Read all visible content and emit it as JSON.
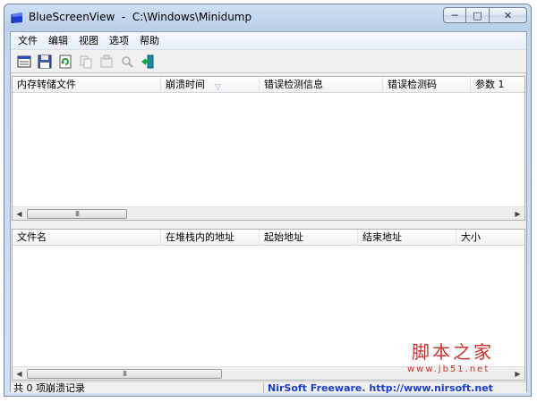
{
  "window": {
    "title": "BlueScreenView  -  C:\\Windows\\Minidump",
    "caption_buttons": {
      "minimize": "─",
      "maximize": "□",
      "close": "✕"
    }
  },
  "menu": [
    "文件",
    "编辑",
    "视图",
    "选项",
    "帮助"
  ],
  "toolbar": {
    "buttons": [
      "properties-icon",
      "save-icon",
      "refresh-icon",
      "copy-icon",
      "copy-props-icon",
      "find-icon",
      "exit-icon"
    ]
  },
  "top_pane": {
    "columns": [
      "内存转储文件",
      "崩溃时间",
      "错误检测信息",
      "错误检测码",
      "参数 1"
    ],
    "sort_indicator": "▽",
    "rows": []
  },
  "bottom_pane": {
    "columns": [
      "文件名",
      "在堆栈内的地址",
      "起始地址",
      "结束地址",
      "大小"
    ],
    "rows": []
  },
  "scrollbar": {
    "left_arrow": "◀",
    "right_arrow": "▶",
    "grip": "III"
  },
  "status": {
    "count_text": "共 0 项崩溃记录",
    "link_text": "NirSoft Freeware.  http://www.nirsoft.net"
  },
  "watermark": {
    "title": "脚本之家",
    "url": "www.jb51.net"
  },
  "colors": {
    "link": "#1a3fc9",
    "watermark": "#c7342b",
    "title_bar": "#c6d7ec"
  }
}
